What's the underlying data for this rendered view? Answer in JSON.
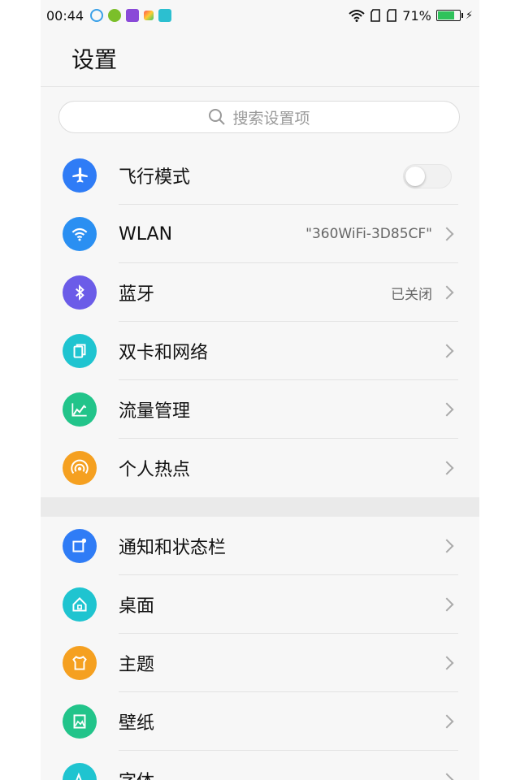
{
  "status_bar": {
    "time": "00:44",
    "battery_text": "71%",
    "battery_level": 0.71,
    "notification_icons": [
      "qq-icon",
      "app-green-icon",
      "app-purple-icon",
      "app-colorful-icon",
      "usb-icon"
    ]
  },
  "header": {
    "title": "设置"
  },
  "search": {
    "placeholder": "搜索设置项"
  },
  "group1": [
    {
      "label": "飞行模式",
      "value": "",
      "icon": "airplane-icon",
      "color": "#2f7cf6",
      "control": "toggle",
      "toggle_on": false
    },
    {
      "label": "WLAN",
      "value": "\"360WiFi-3D85CF\"",
      "icon": "wifi-icon",
      "color": "#2a8ff2",
      "control": "chevron"
    },
    {
      "label": "蓝牙",
      "value": "已关闭",
      "icon": "bluetooth-icon",
      "color": "#6b5ce8",
      "control": "chevron"
    },
    {
      "label": "双卡和网络",
      "value": "",
      "icon": "sim-icon",
      "color": "#1fc4d0",
      "control": "chevron"
    },
    {
      "label": "流量管理",
      "value": "",
      "icon": "data-usage-icon",
      "color": "#22c48a",
      "control": "chevron"
    },
    {
      "label": "个人热点",
      "value": "",
      "icon": "hotspot-icon",
      "color": "#f5a020",
      "control": "chevron"
    }
  ],
  "group2": [
    {
      "label": "通知和状态栏",
      "value": "",
      "icon": "notification-icon",
      "color": "#2f7cf6",
      "control": "chevron"
    },
    {
      "label": "桌面",
      "value": "",
      "icon": "home-icon",
      "color": "#1fc4d0",
      "control": "chevron"
    },
    {
      "label": "主题",
      "value": "",
      "icon": "theme-icon",
      "color": "#f5a020",
      "control": "chevron"
    },
    {
      "label": "壁纸",
      "value": "",
      "icon": "wallpaper-icon",
      "color": "#22c48a",
      "control": "chevron"
    },
    {
      "label": "字体",
      "value": "",
      "icon": "font-icon",
      "color": "#1fc4d0",
      "control": "chevron"
    }
  ]
}
